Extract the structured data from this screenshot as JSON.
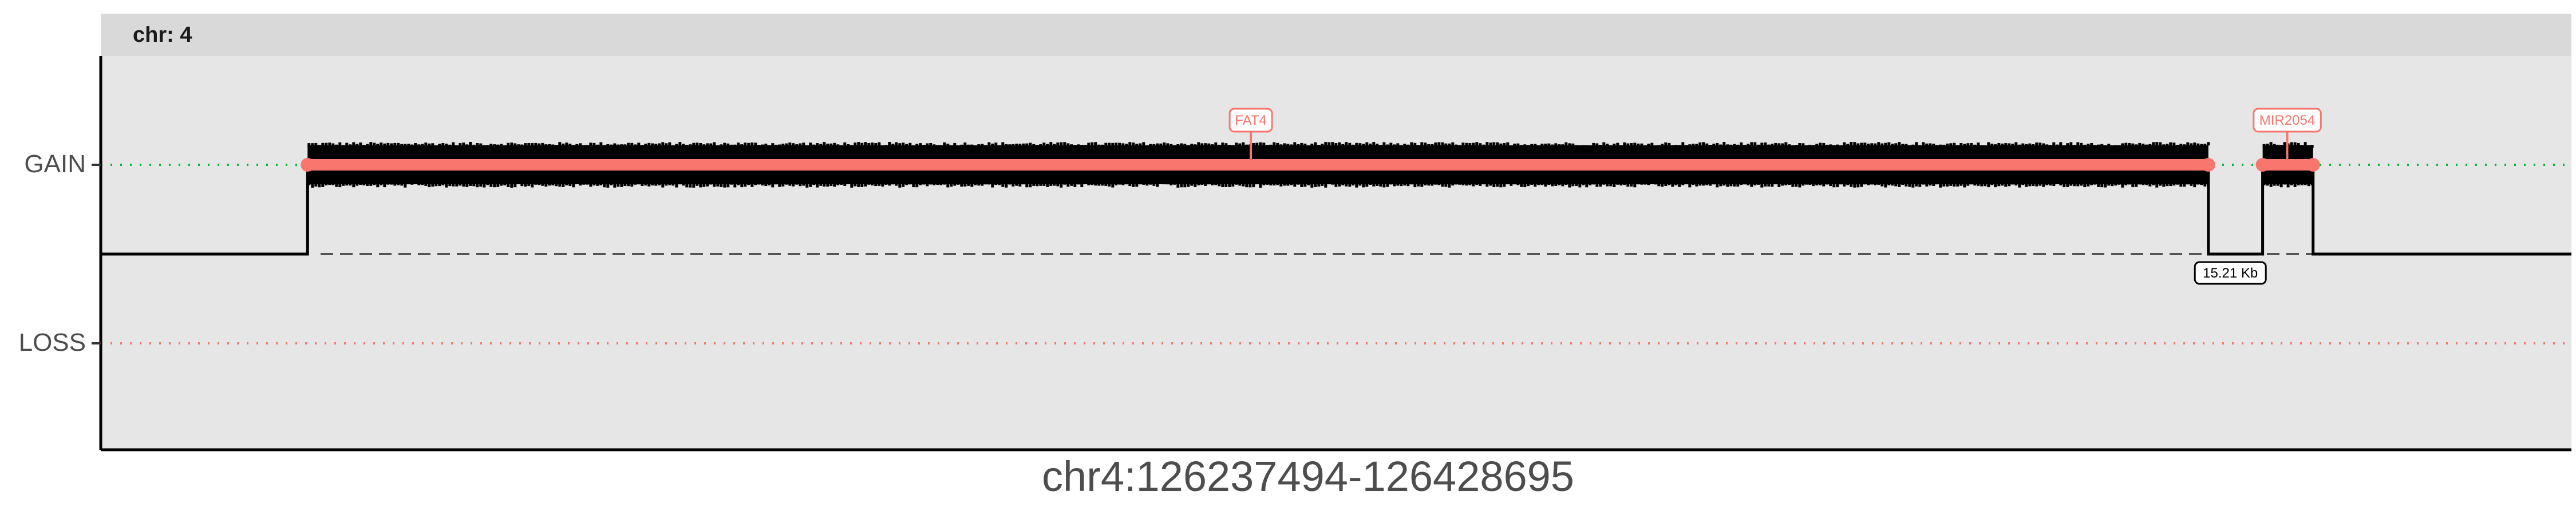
{
  "chart_data": {
    "type": "step-segments",
    "title": "",
    "xlabel": "chr4:126237494-126428695",
    "ylabel": "",
    "strip_label": "chr: 4",
    "x_range": [
      126237494,
      126428695
    ],
    "y_levels": [
      "GAIN",
      "LOSS"
    ],
    "grid": false,
    "segments": [
      {
        "state": "GAIN",
        "start": 126253500,
        "end": 126400600
      },
      {
        "state": "GAIN",
        "start": 126404800,
        "end": 126408700
      }
    ],
    "genes": [
      {
        "name": "FAT4",
        "position": 126326500
      },
      {
        "name": "MIR2054",
        "position": 126406700
      }
    ],
    "gap_annotation": {
      "label": "15.21 Kb",
      "position": 126402300
    },
    "colors": {
      "panel": "#e6e6e6",
      "strip": "#d9d9d9",
      "segment": "#f8766d",
      "gain_ref": "#00ba38",
      "loss_ref": "#f8766d",
      "step": "#000000",
      "axis_text": "#4d4d4d"
    }
  }
}
